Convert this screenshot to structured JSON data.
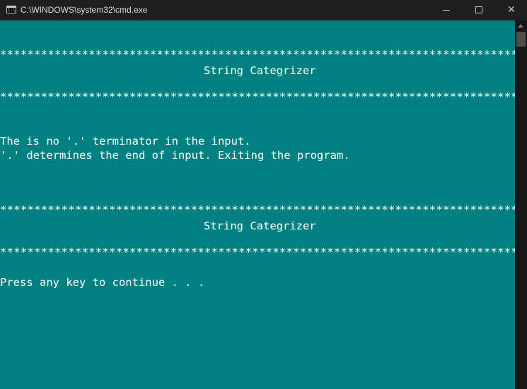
{
  "window": {
    "title": "C:\\WINDOWS\\system32\\cmd.exe",
    "icon": "cmd-icon",
    "controls": {
      "minimize": "minimize-icon",
      "maximize": "maximize-icon",
      "close_glyph": "✕"
    }
  },
  "console": {
    "rule_top_1": "******************************************************************************",
    "header_1": "String Categrizer",
    "rule_bottom_1": "******************************************************************************",
    "message_1": "The is no '.' terminator in the input.",
    "message_2": "'.' determines the end of input. Exiting the program.",
    "rule_top_2": "******************************************************************************",
    "header_2": "String Categrizer",
    "rule_bottom_2": "******************************************************************************",
    "prompt": "Press any key to continue . . ."
  },
  "colors": {
    "background": "#008080",
    "text": "#ffffff",
    "titlebar": "#1f1f1f"
  }
}
